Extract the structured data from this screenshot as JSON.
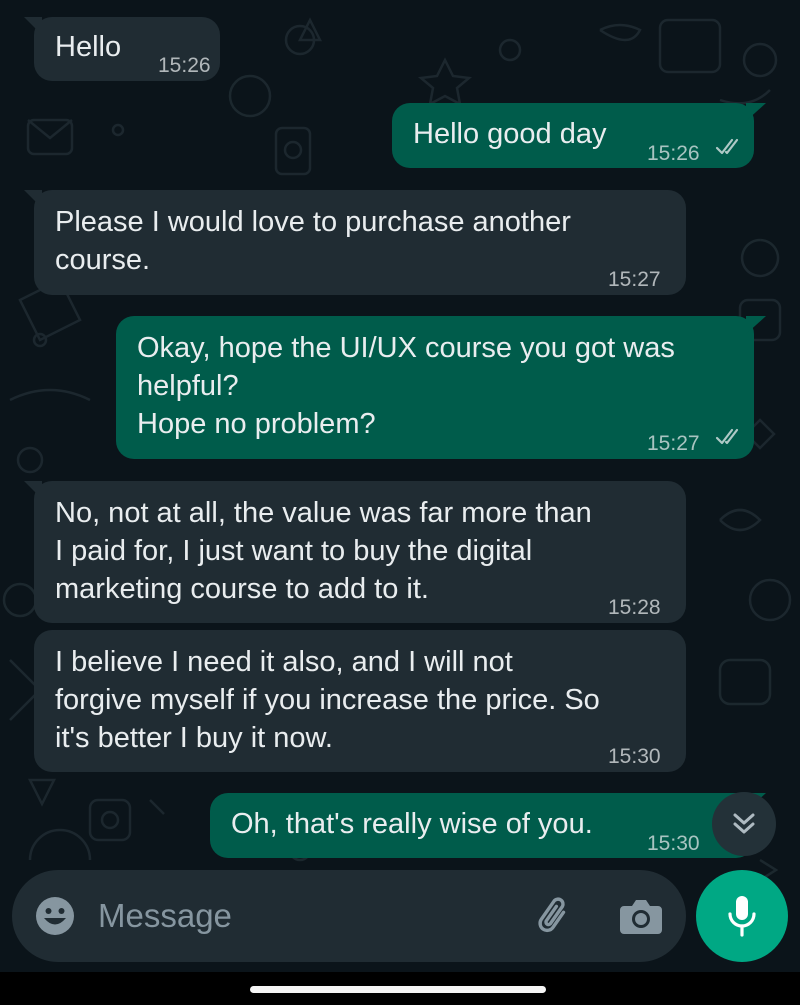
{
  "colors": {
    "background": "#0b141a",
    "incoming_bubble": "#202c33",
    "outgoing_bubble": "#005c4b",
    "text": "#e9edef",
    "accent": "#00a884",
    "placeholder": "#8696a0"
  },
  "messages": [
    {
      "direction": "incoming",
      "text": "Hello",
      "time": "15:26"
    },
    {
      "direction": "outgoing",
      "text": "Hello good day",
      "time": "15:26",
      "status": "read-ticks-icon"
    },
    {
      "direction": "incoming",
      "text": "Please I would love to purchase another\ncourse.",
      "time": "15:27"
    },
    {
      "direction": "outgoing",
      "text": "Okay, hope the UI/UX course you got was\nhelpful?\nHope no problem?",
      "time": "15:27",
      "status": "read-ticks-icon"
    },
    {
      "direction": "incoming",
      "text": "No, not at all, the value was far more than\nI paid for, I just want to buy the digital\nmarketing course to add to it.",
      "time": "15:28"
    },
    {
      "direction": "incoming",
      "text": "I believe I need it also, and I will not\nforgive myself if you increase the price. So\nit's better I buy it now.",
      "time": "15:30"
    },
    {
      "direction": "outgoing",
      "text": "Oh, that's really wise of you.",
      "time": "15:30"
    }
  ],
  "composer": {
    "placeholder": "Message",
    "emoji_icon": "smiley-icon",
    "attach_icon": "paperclip-icon",
    "camera_icon": "camera-icon",
    "send_icon": "microphone-icon"
  },
  "scroll_button_icon": "double-chevron-down-icon"
}
